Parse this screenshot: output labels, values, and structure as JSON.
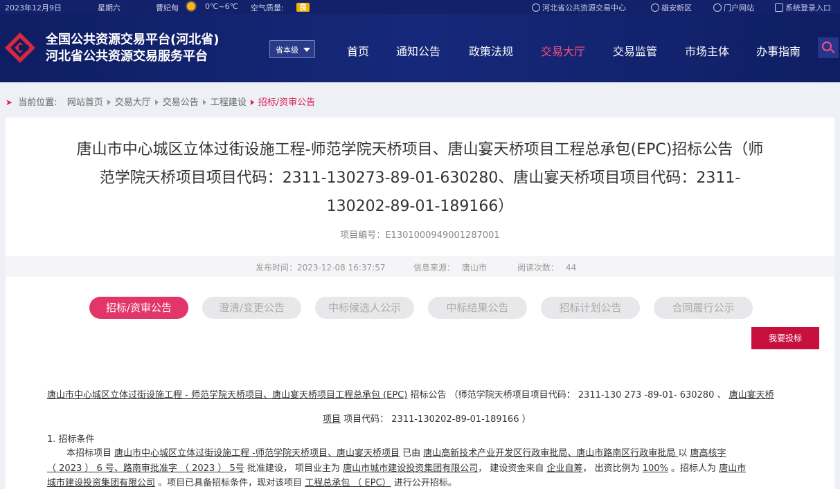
{
  "topbar": {
    "date": "2023年12月9日",
    "weekday": "星期六",
    "district": "曹妃甸",
    "weather_icon": "sun-icon",
    "temperature": "0℃~6℃",
    "air_quality_label": "空气质量:",
    "air_quality_value": "良",
    "links": [
      "河北省公共资源交易中心",
      "雄安新区",
      "门户网站",
      "系统登录入口"
    ]
  },
  "header": {
    "title_line1": "全国公共资源交易平台(河北省)",
    "title_line2": "河北省公共资源交易服务平台",
    "level_select": "省本级",
    "nav": [
      "首页",
      "通知公告",
      "政策法规",
      "交易大厅",
      "交易监管",
      "市场主体",
      "办事指南"
    ],
    "active_nav": "交易大厅",
    "accent_color": "#ff4f7d"
  },
  "breadcrumb": {
    "label": "当前位置:",
    "items": [
      "网站首页",
      "交易大厅",
      "交易公告",
      "工程建设"
    ],
    "current": "招标/资审公告"
  },
  "article": {
    "title_lines": [
      "唐山市中心城区立体过街设施工程-师范学院天桥项目、唐山宴天桥项目工程总承包(EPC)招标公告（师",
      "范学院天桥项目项目代码：2311-130273-89-01-630280、唐山宴天桥项目项目代码：2311-",
      "130202-89-01-189166）"
    ],
    "project_no_label": "项目编号：",
    "project_no": "E1301000949001287001",
    "publish_label": "发布时间：",
    "publish_time": "2023-12-08 16:37:57",
    "source_label": "信息来源：",
    "source": "唐山市",
    "views_label": "阅读次数：",
    "views": "44"
  },
  "tabs": [
    "招标/资审公告",
    "澄清/变更公告",
    "中标候选人公示",
    "中标结果公告",
    "招标计划公告",
    "合同履行公示"
  ],
  "bid_button": "我要投标",
  "content": {
    "heading_line1_u1": "唐山市中心城区立体过街设施工程 - 师范学院天桥项目、唐山宴天桥项目工程总承包 (EPC)",
    "heading_line1_t1": " 招标公告 （师范学院天桥项目项目代码：  2311-130 273 -89-01- 630280 、 ",
    "heading_line1_u2": "唐山宴天桥",
    "heading_line2_u1": "项目",
    "heading_line2_t1": " 项目代码：  2311-130202-89-01-189166 ）",
    "section1": "1. 招标条件",
    "p1_t1": "本招标项目 ",
    "p1_u1": "唐山市中心城区立体过街设施工程 -师范学院天桥项目、唐山宴天桥项目",
    "p1_t2": " 已由 ",
    "p1_u2": " 唐山高新技术产业开发区行政审批局、唐山市路南区行政审批局 ",
    "p1_t3": " 以 ",
    "p1_u3": "唐高核字",
    "p2_u1": "（ 2023 ） 6 号、路南审批准字 （ 2023 ） 5号",
    "p2_t1": " 批准建设， 项目业主为 ",
    "p2_u2": "唐山市城市建设投资集团有限公司",
    "p2_t2": "， 建设资金来自 ",
    "p2_u3": "企业自筹",
    "p2_t3": "， 出资比例为 ",
    "p2_u4": "100%",
    "p2_t4": " 。招标人为 ",
    "p2_u5": "唐山市",
    "p3_u1": "城市建设投资集团有限公司",
    "p3_t1": " 。项目已具备招标条件，现对该项目 ",
    "p3_u2": "工程总承包 （ EPC）",
    "p3_t2": " 进行公开招标。"
  }
}
